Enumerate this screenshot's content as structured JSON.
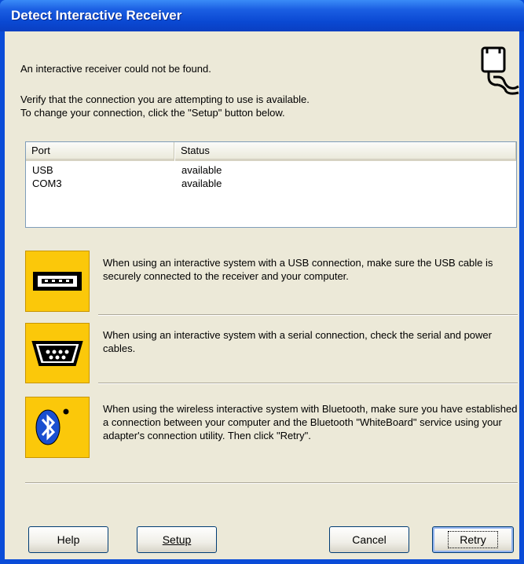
{
  "window": {
    "title": "Detect Interactive Receiver"
  },
  "message": "An interactive receiver could not be found.",
  "instructions": {
    "line1": "Verify that the connection you are attempting to use is available.",
    "line2": "To change your connection, click the \"Setup\" button below."
  },
  "port_table": {
    "columns": [
      "Port",
      "Status"
    ],
    "rows": [
      {
        "port": "USB",
        "status": "available"
      },
      {
        "port": "COM3",
        "status": "available"
      }
    ]
  },
  "info": [
    {
      "icon": "usb-connector-icon",
      "text": "When using an interactive system with a USB connection, make sure the USB cable is securely connected to the receiver and your computer."
    },
    {
      "icon": "serial-connector-icon",
      "text": "When using an interactive system with a serial connection, check the serial and power cables."
    },
    {
      "icon": "bluetooth-icon",
      "text": "When using the wireless interactive system with Bluetooth, make sure you have established a connection between your computer and the Bluetooth \"WhiteBoard\" service using your adapter's connection utility.  Then click \"Retry\"."
    }
  ],
  "buttons": {
    "help": "Help",
    "setup": "Setup",
    "cancel": "Cancel",
    "retry": "Retry"
  },
  "colors": {
    "title_bar": "#0a48d2",
    "dialog_bg": "#ece9d8",
    "icon_bg": "#fbc80a"
  }
}
